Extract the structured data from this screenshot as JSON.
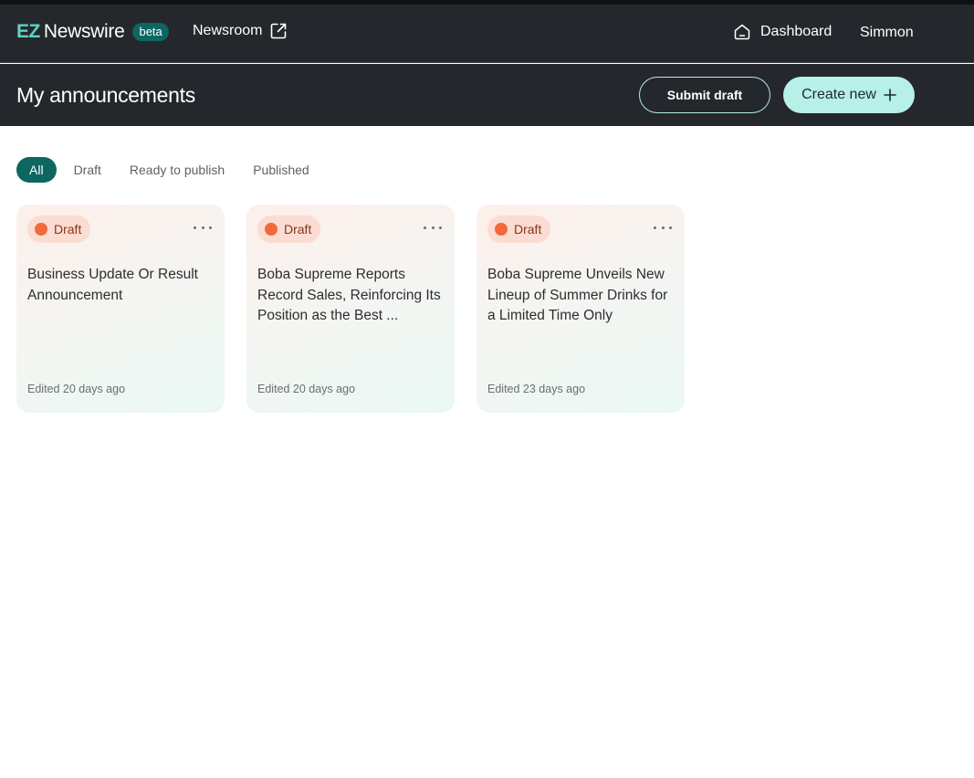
{
  "navbar": {
    "logo_ez": "EZ",
    "logo_name": "Newswire",
    "beta_label": "beta",
    "newsroom_label": "Newsroom",
    "dashboard_label": "Dashboard",
    "user_name": "Simmon"
  },
  "header": {
    "title": "My announcements",
    "submit_draft_label": "Submit draft",
    "create_new_label": "Create new"
  },
  "filters": [
    {
      "label": "All",
      "active": true
    },
    {
      "label": "Draft",
      "active": false
    },
    {
      "label": "Ready to publish",
      "active": false
    },
    {
      "label": "Published",
      "active": false
    }
  ],
  "cards": [
    {
      "status": "Draft",
      "title": "Business Update Or Result Announcement",
      "edited": "Edited 20 days ago"
    },
    {
      "status": "Draft",
      "title": "Boba Supreme Reports Record Sales, Reinforcing Its Position as the Best ...",
      "edited": "Edited 20 days ago"
    },
    {
      "status": "Draft",
      "title": "Boba Supreme Unveils New Lineup of Summer Drinks for a Limited Time Only",
      "edited": "Edited 23 days ago"
    }
  ],
  "colors": {
    "nav_bg": "#24272b",
    "accent_teal": "#0e6661",
    "create_button": "#b7f0e7",
    "draft_dot": "#f06a3a"
  },
  "icons": {
    "newsroom": "external-link-icon",
    "dashboard": "home-icon",
    "create": "plus-icon",
    "card_menu": "more-horizontal-icon"
  }
}
